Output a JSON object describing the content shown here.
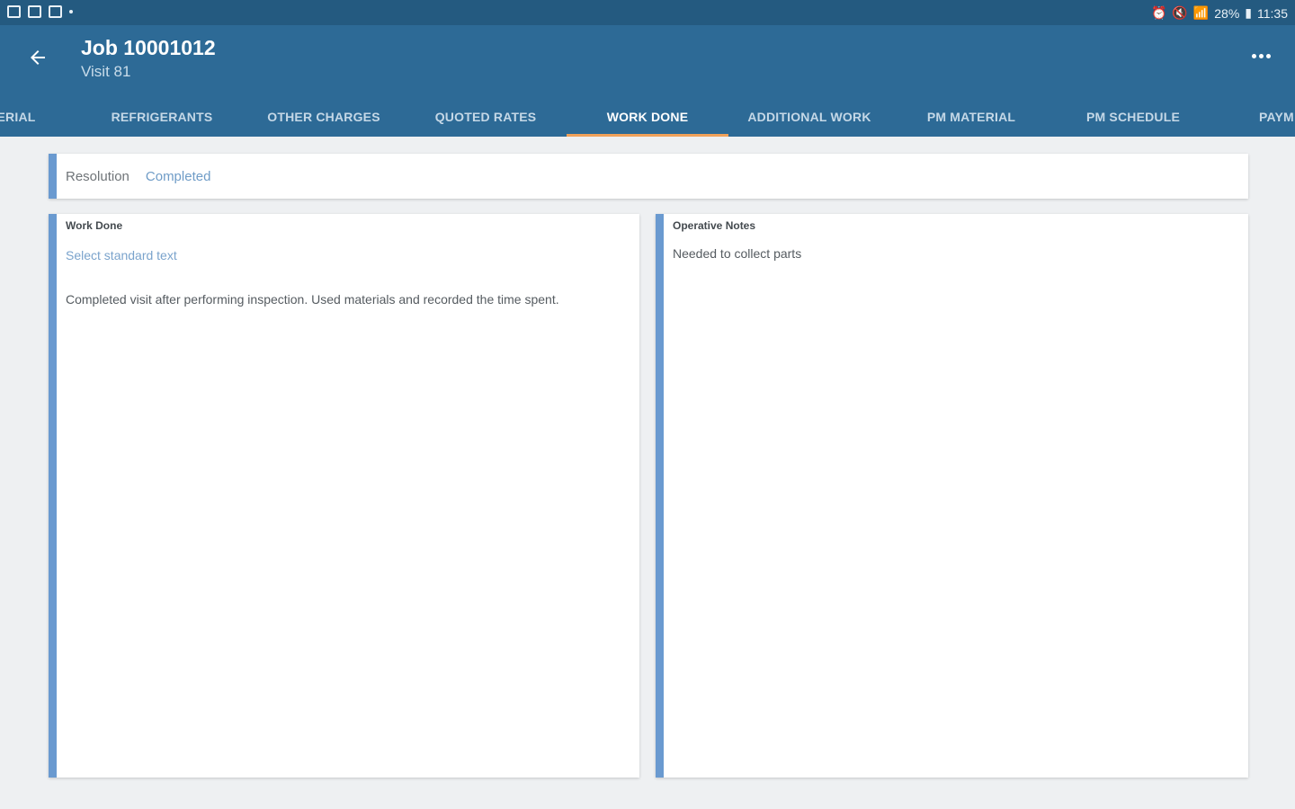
{
  "status_bar": {
    "battery": "28%",
    "time": "11:35"
  },
  "header": {
    "title": "Job 10001012",
    "subtitle": "Visit 81"
  },
  "tabs": [
    {
      "label": "ERIAL"
    },
    {
      "label": "REFRIGERANTS"
    },
    {
      "label": "OTHER CHARGES"
    },
    {
      "label": "QUOTED RATES"
    },
    {
      "label": "WORK DONE",
      "active": true
    },
    {
      "label": "ADDITIONAL WORK"
    },
    {
      "label": "PM MATERIAL"
    },
    {
      "label": "PM SCHEDULE"
    },
    {
      "label": "PAYM"
    }
  ],
  "resolution": {
    "label": "Resolution",
    "value": "Completed"
  },
  "work_done": {
    "title": "Work Done",
    "select_link": "Select standard text",
    "text": "Completed visit after performing inspection. Used materials and recorded the time spent."
  },
  "operative_notes": {
    "title": "Operative Notes",
    "text": "Needed to collect parts"
  },
  "colors": {
    "status_bar": "#245a80",
    "app_bar": "#2d6a96",
    "tab_indicator": "#f0a15a",
    "card_accent": "#6a9ad0",
    "link": "#6f9cc7",
    "background": "#eef0f2"
  }
}
